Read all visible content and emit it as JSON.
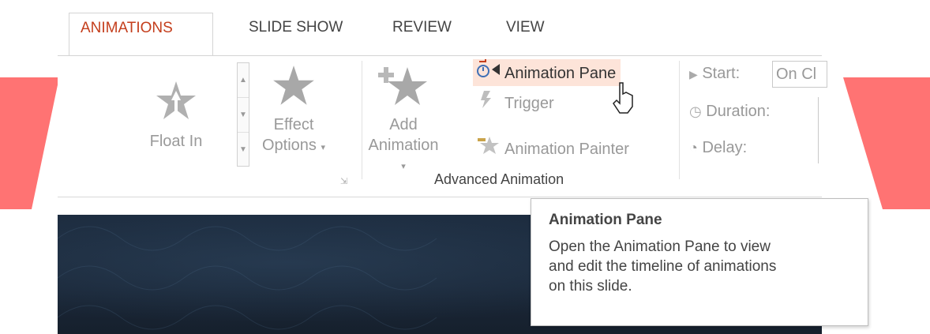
{
  "tabs": [
    "ANIMATIONS",
    "SLIDE SHOW",
    "REVIEW",
    "VIEW"
  ],
  "active_tab_index": 0,
  "gallery": {
    "selected_label": "Float In"
  },
  "effect_options": {
    "label_line1": "Effect",
    "label_line2": "Options"
  },
  "advanced_animation": {
    "add_label_line1": "Add",
    "add_label_line2": "Animation",
    "animation_pane": "Animation Pane",
    "trigger": "Trigger",
    "animation_painter": "Animation Painter",
    "group_label": "Advanced Animation"
  },
  "timing": {
    "start_label": "Start:",
    "start_value": "On Cl",
    "duration_label": "Duration:",
    "delay_label": "Delay:"
  },
  "tooltip": {
    "title": "Animation Pane",
    "line1": "Open the Animation Pane to view",
    "line2": "and edit the timeline of animations",
    "line3": "on this slide."
  },
  "colors": {
    "accent_tab": "#c43e1c",
    "highlight": "#fde4d9",
    "watermark_red": "#ff4b4b",
    "watermark_blue": "#4a55c9",
    "watermark_yellow": "#f6d23a"
  },
  "icons": [
    "float-in-star-icon",
    "effect-options-star-icon",
    "add-animation-star-icon",
    "animation-pane-icon",
    "trigger-icon",
    "animation-painter-icon",
    "start-play-icon",
    "duration-clock-icon",
    "delay-clock-icon",
    "mouse-cursor-icon"
  ]
}
